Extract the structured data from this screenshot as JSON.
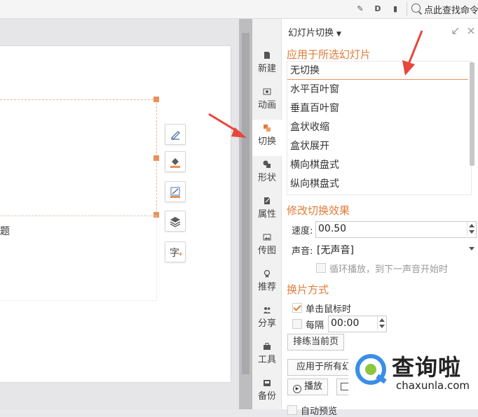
{
  "topbar": {
    "icons": [
      "tool-icon",
      "d-icon",
      "comment-icon"
    ],
    "search_label": "点此查找命令"
  },
  "sidebar": {
    "tabs": [
      {
        "label": "新建",
        "icon": "new-icon"
      },
      {
        "label": "动画",
        "icon": "animation-icon"
      },
      {
        "label": "切换",
        "icon": "transition-icon"
      },
      {
        "label": "形状",
        "icon": "shape-icon"
      },
      {
        "label": "属性",
        "icon": "property-icon"
      },
      {
        "label": "传图",
        "icon": "upload-image-icon"
      },
      {
        "label": "推荐",
        "icon": "recommend-icon"
      },
      {
        "label": "分享",
        "icon": "share-icon"
      },
      {
        "label": "工具",
        "icon": "toolbox-icon"
      },
      {
        "label": "备份",
        "icon": "backup-icon"
      }
    ],
    "active_tab": "切换"
  },
  "slide": {
    "text_fragment": "题"
  },
  "float_tools": [
    "collapse-icon",
    "edit-shape-icon",
    "fill-icon",
    "line-color-icon",
    "layers-icon",
    "text-effect-icon"
  ],
  "panel": {
    "title": "幻灯片切换",
    "section_apply": "应用于所选幻灯片",
    "transitions": [
      "无切换",
      "水平百叶窗",
      "垂直百叶窗",
      "盒状收缩",
      "盒状展开",
      "横向棋盘式",
      "纵向棋盘式"
    ],
    "selected_transition": "无切换",
    "section_modify": "修改切换效果",
    "speed_label": "速度:",
    "speed_value": "00.50",
    "sound_label": "声音:",
    "sound_value": "[无声音]",
    "loop_label": "循环播放，到下一声音开始时",
    "section_advance": "换片方式",
    "on_click_label": "单击鼠标时",
    "on_click_checked": true,
    "every_label": "每隔",
    "every_value": "00:00",
    "every_checked": false,
    "rehearse_button": "排练当前页",
    "apply_all_button": "应用于所有幻灯",
    "play_button": "播放",
    "autopreview_label": "自动预览"
  },
  "watermark": {
    "brand": "查询啦",
    "domain": "chaxunla.com"
  },
  "colors": {
    "accent": "#e07b39",
    "arrow": "#e8453c",
    "selection_handle": "#e8925a",
    "watermark_blue": "#3a8ee6",
    "watermark_green": "#8dc63f"
  }
}
